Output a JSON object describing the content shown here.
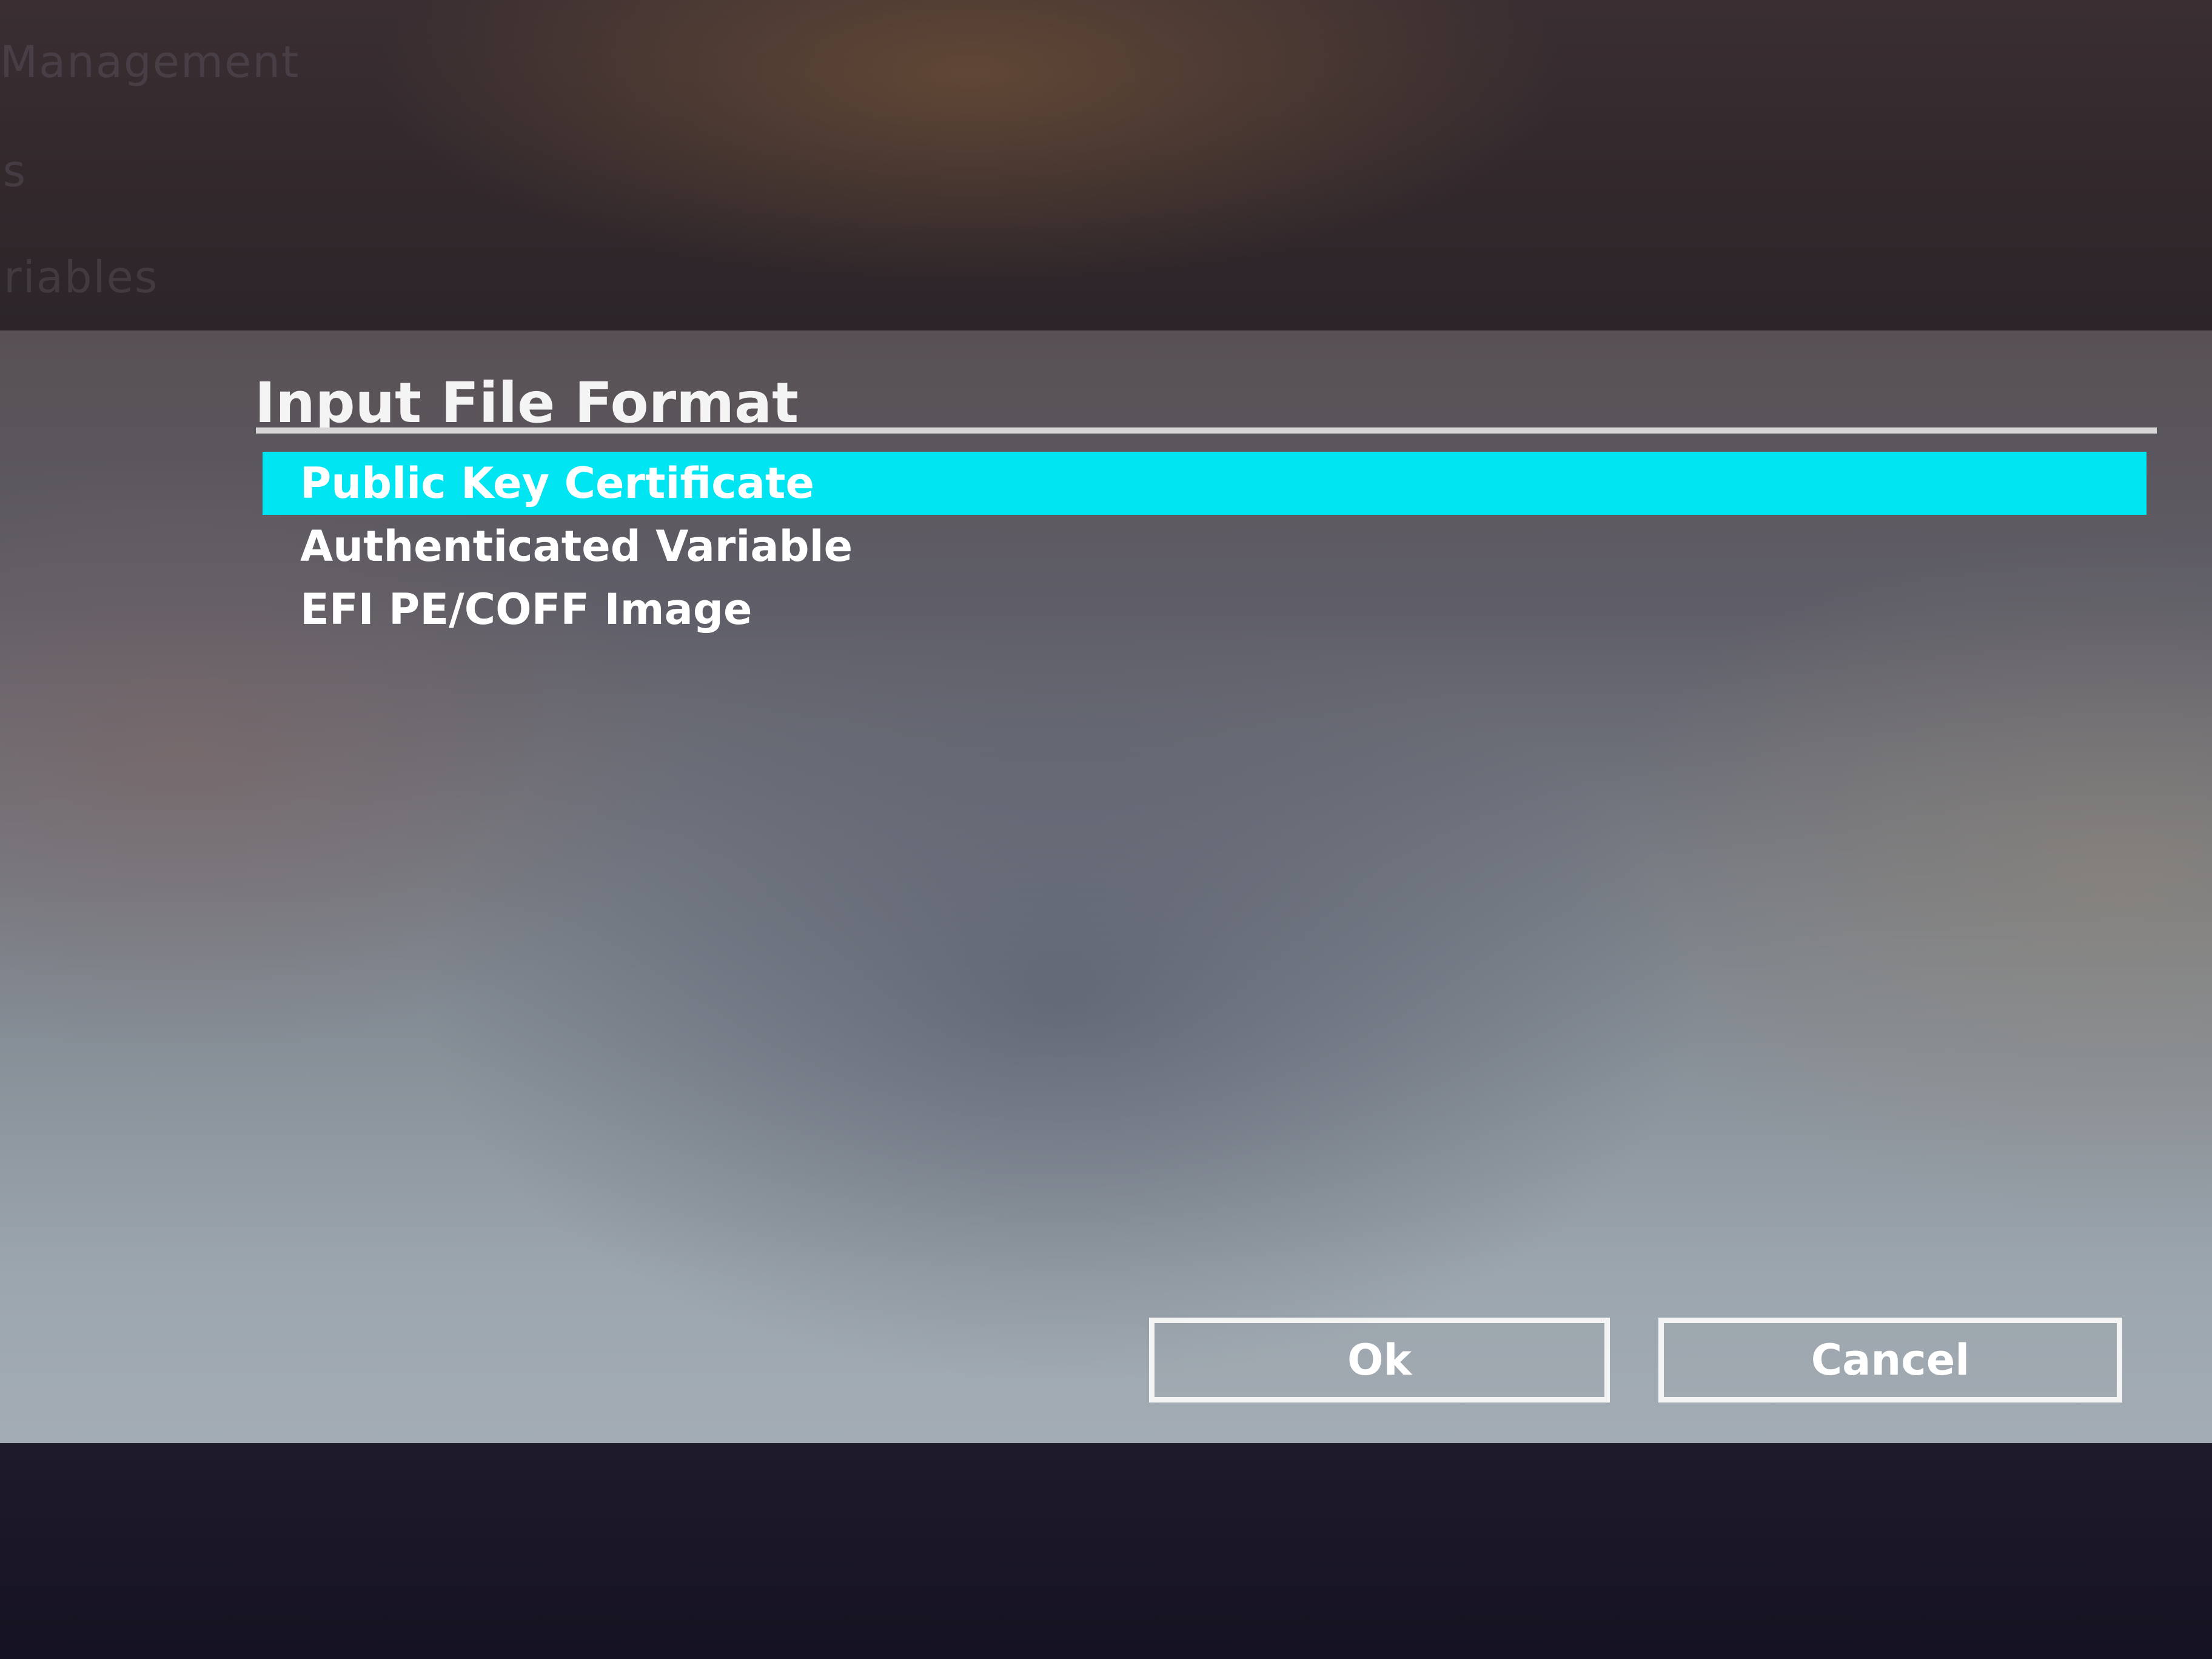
{
  "background_menu": {
    "items": [
      "Management",
      "ys",
      "ariables"
    ]
  },
  "dialog": {
    "title": "Input File Format",
    "options": [
      {
        "label": "Public Key Certificate",
        "selected": true
      },
      {
        "label": "Authenticated Variable",
        "selected": false
      },
      {
        "label": "EFI PE/COFF Image",
        "selected": false
      }
    ],
    "buttons": {
      "ok_label": "Ok",
      "cancel_label": "Cancel"
    }
  },
  "colors": {
    "selection_highlight": "#00e5f2",
    "text": "#ffffff",
    "button_border": "#f4f4f4"
  }
}
